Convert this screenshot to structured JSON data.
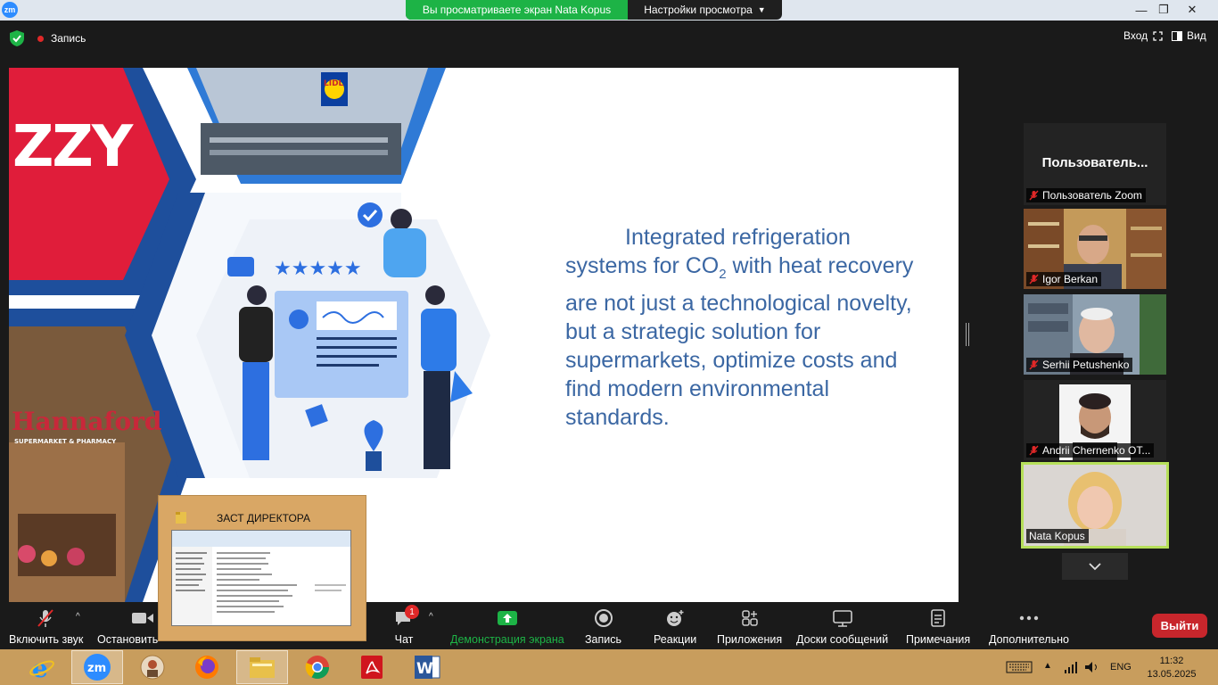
{
  "app": {
    "logo_text": "zm"
  },
  "share_banner": {
    "viewing": "Вы просматриваете экран Nata Kopus",
    "settings": "Настройки просмотра"
  },
  "header": {
    "record": "Запись",
    "enter": "Вход",
    "view": "Вид"
  },
  "slide": {
    "text_before": "Integrated refrigeration systems for CO",
    "text_sub": "2",
    "text_after": " with heat recovery are not just a technological novelty, but a strategic solution for supermarkets, optimize costs and find modern environmental standards.",
    "logo_text": "ZZY",
    "store_sign": "Hannaford",
    "store_sign_sub": "SUPERMARKET & PHARMACY",
    "lidl_text": "LIDL"
  },
  "mini_window": {
    "title": "ЗАСТ ДИРЕКТОРА"
  },
  "participants": [
    {
      "name": "Пользователь Zoom",
      "header": "Пользователь...",
      "muted": true,
      "video": false
    },
    {
      "name": "Igor Berkan",
      "muted": true,
      "video": true
    },
    {
      "name": "Serhii Petushenko",
      "muted": true,
      "video": true
    },
    {
      "name": "Andrii Chernenko OT...",
      "muted": true,
      "video": true
    },
    {
      "name": "Nata Kopus",
      "muted": false,
      "video": true,
      "active_speaker": true
    }
  ],
  "toolbar": {
    "unmute": "Включить звук",
    "stop_video": "Остановить",
    "chat": "Чат",
    "chat_badge": "1",
    "share": "Демонстрация экрана",
    "record": "Запись",
    "reactions": "Реакции",
    "apps": "Приложения",
    "whiteboards": "Доски сообщений",
    "notes": "Примечания",
    "more": "Дополнительно",
    "leave": "Выйти"
  },
  "taskbar": {
    "apps": [
      "internet-explorer-icon",
      "zoom-icon",
      "user-folder-icon",
      "firefox-icon",
      "file-explorer-icon",
      "chrome-icon",
      "acrobat-icon",
      "word-icon"
    ],
    "lang": "ENG",
    "time": "11:32",
    "date": "13.05.2025"
  },
  "colors": {
    "share_green": "#1db346",
    "leave_red": "#c8262c",
    "slide_text": "#3b67a3",
    "taskbar": "#c89d5d",
    "active_speaker": "#b6e05a"
  }
}
